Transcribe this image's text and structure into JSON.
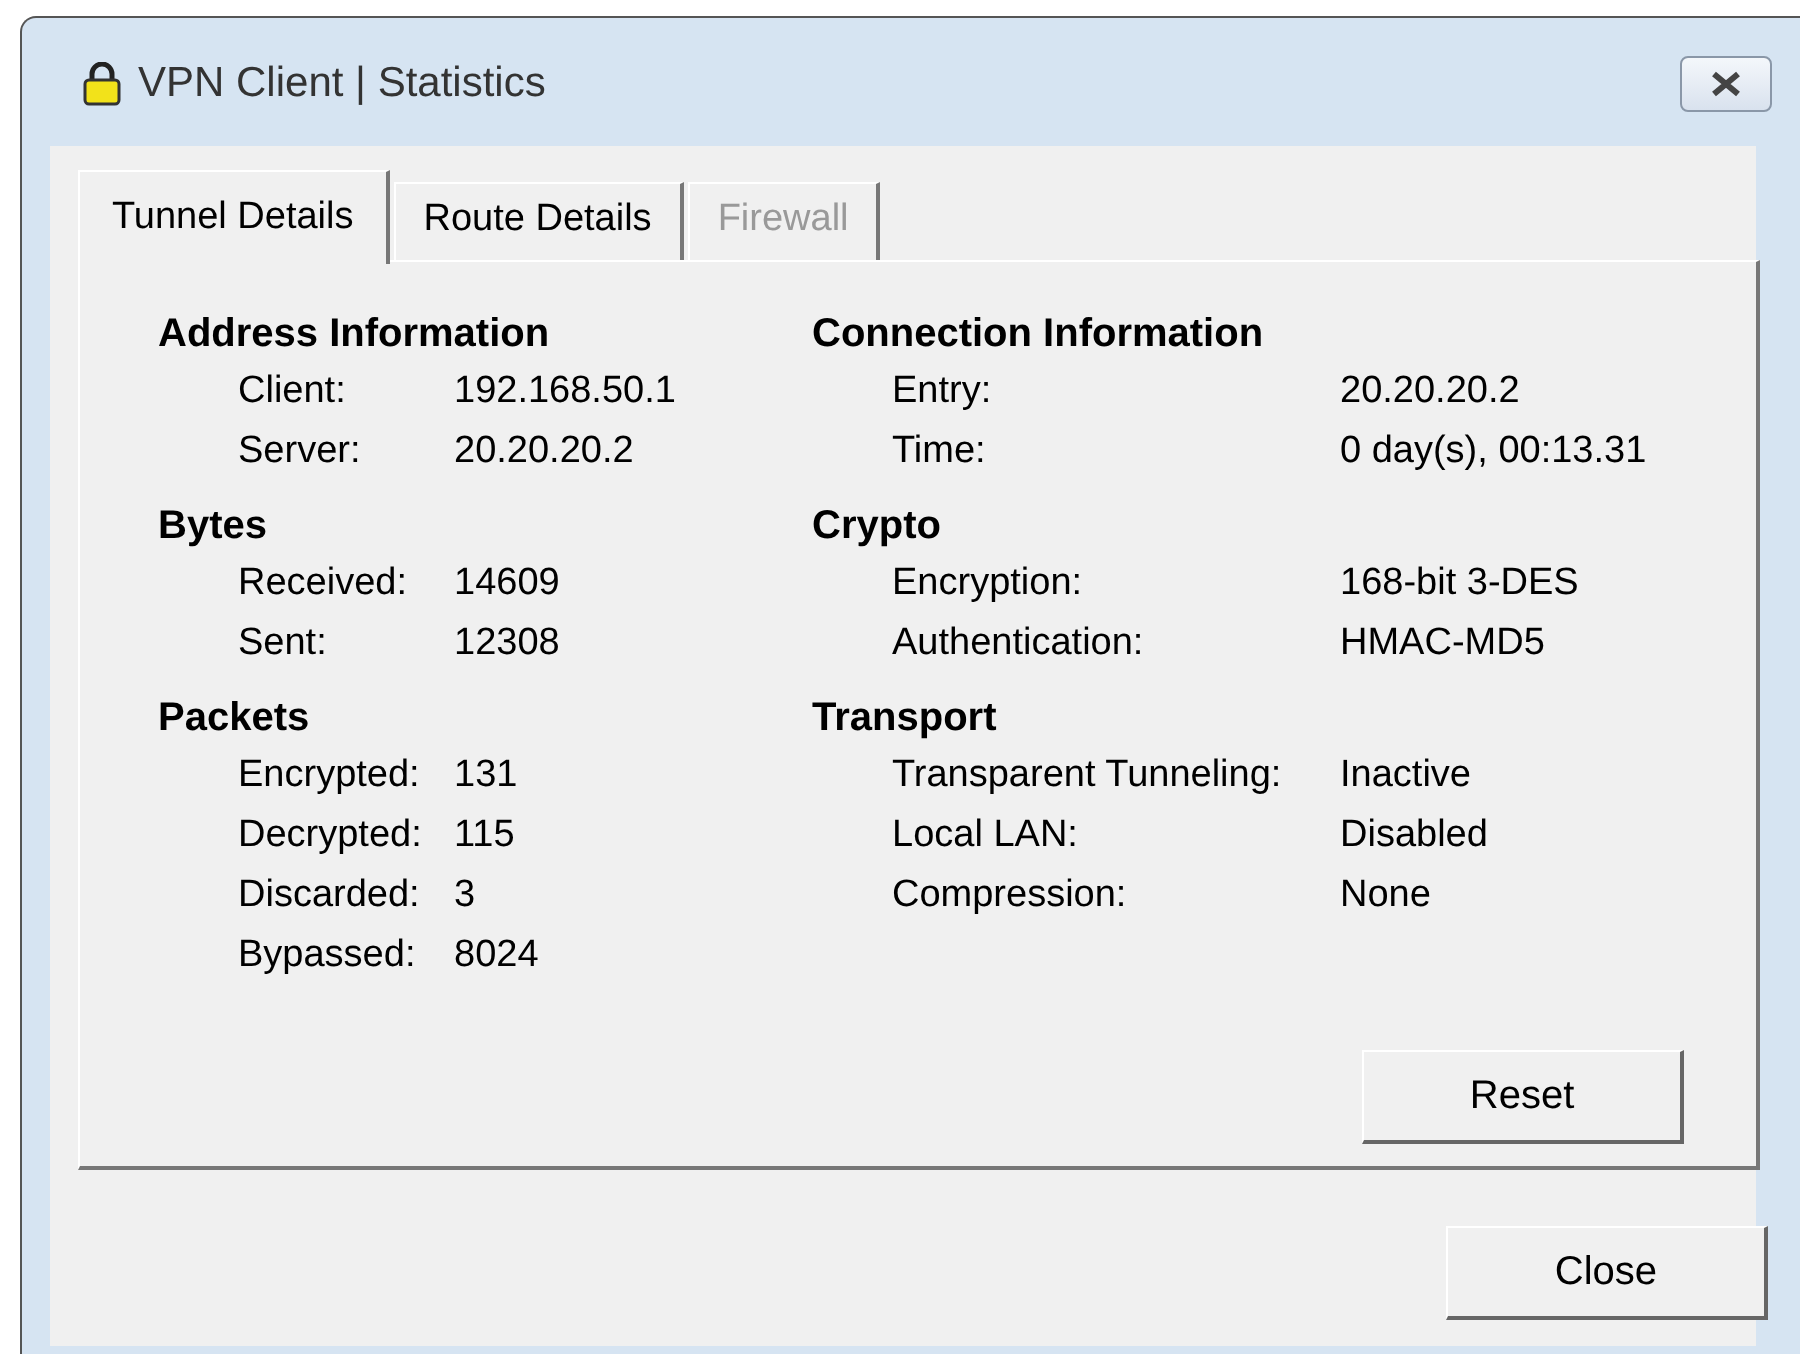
{
  "window": {
    "title": "VPN Client | Statistics"
  },
  "tabs": [
    {
      "label": "Tunnel Details",
      "selected": true,
      "disabled": false
    },
    {
      "label": "Route Details",
      "selected": false,
      "disabled": false
    },
    {
      "label": "Firewall",
      "selected": false,
      "disabled": true
    }
  ],
  "columns": [
    {
      "sections": [
        {
          "title": "Address Information",
          "rows": [
            {
              "label": "Client:",
              "value": "192.168.50.1"
            },
            {
              "label": "Server:",
              "value": "20.20.20.2"
            }
          ]
        },
        {
          "title": "Bytes",
          "rows": [
            {
              "label": "Received:",
              "value": "14609"
            },
            {
              "label": "Sent:",
              "value": "12308"
            }
          ]
        },
        {
          "title": "Packets",
          "rows": [
            {
              "label": "Encrypted:",
              "value": "131"
            },
            {
              "label": "Decrypted:",
              "value": "115"
            },
            {
              "label": "Discarded:",
              "value": "3"
            },
            {
              "label": "Bypassed:",
              "value": "8024"
            }
          ]
        }
      ]
    },
    {
      "sections": [
        {
          "title": "Connection Information",
          "rows": [
            {
              "label": "Entry:",
              "value": "20.20.20.2"
            },
            {
              "label": "Time:",
              "value": "0 day(s), 00:13.31"
            }
          ]
        },
        {
          "title": "Crypto",
          "rows": [
            {
              "label": "Encryption:",
              "value": "168-bit 3-DES"
            },
            {
              "label": "Authentication:",
              "value": "HMAC-MD5"
            }
          ]
        },
        {
          "title": "Transport",
          "rows": [
            {
              "label": "Transparent Tunneling:",
              "value": "Inactive"
            },
            {
              "label": "Local LAN:",
              "value": "Disabled"
            },
            {
              "label": "Compression:",
              "value": "None"
            }
          ]
        }
      ]
    }
  ],
  "buttons": {
    "reset": "Reset",
    "close": "Close"
  }
}
